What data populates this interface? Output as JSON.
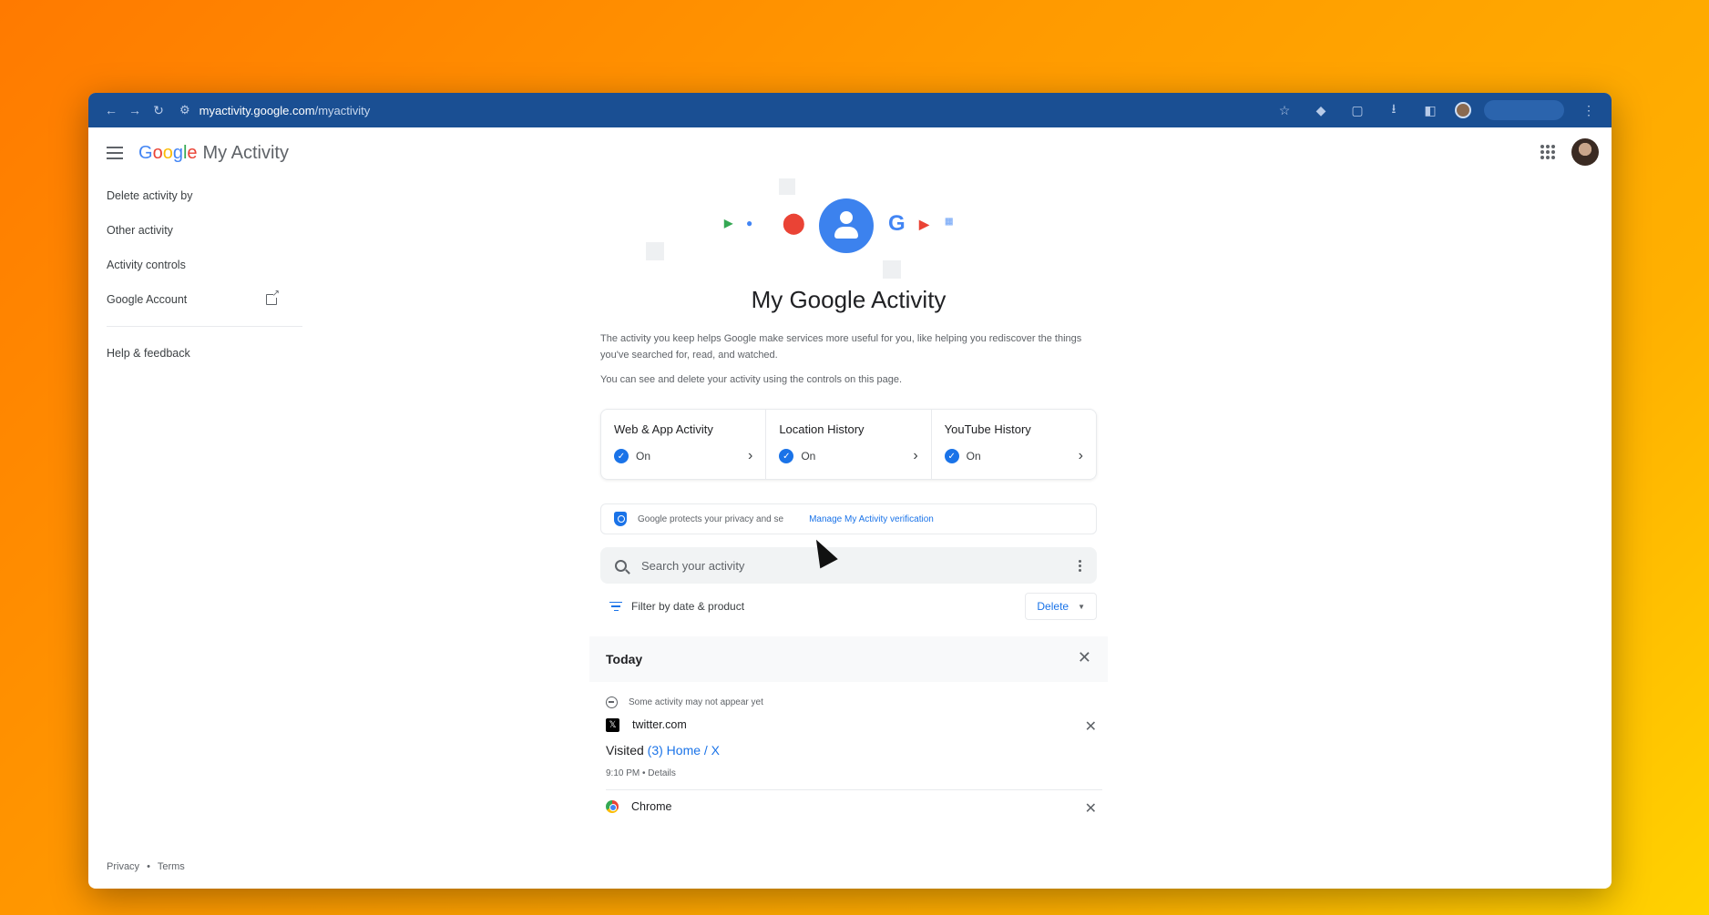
{
  "browser": {
    "url_host": "myactivity.google.com",
    "url_path": "/myactivity"
  },
  "header": {
    "logo_letters": [
      "G",
      "o",
      "o",
      "g",
      "l",
      "e"
    ],
    "product_name": "My Activity"
  },
  "sidebar": {
    "items": [
      {
        "label": "Delete activity by"
      },
      {
        "label": "Other activity"
      },
      {
        "label": "Activity controls"
      },
      {
        "label": "Google Account"
      }
    ],
    "help_label": "Help & feedback",
    "footer": {
      "privacy": "Privacy",
      "separator": "•",
      "terms": "Terms"
    }
  },
  "main": {
    "title": "My Google Activity",
    "intro": "The activity you keep helps Google make services more useful for you, like helping you rediscover the things you've searched for, read, and watched.",
    "intro2": "You can see and delete your activity using the controls on this page.",
    "controls": [
      {
        "title": "Web & App Activity",
        "status": "On"
      },
      {
        "title": "Location History",
        "status": "On"
      },
      {
        "title": "YouTube History",
        "status": "On"
      }
    ],
    "privacy": {
      "text": "Google protects your privacy and se",
      "link": "Manage My Activity verification"
    },
    "search": {
      "placeholder": "Search your activity"
    },
    "filter_label": "Filter by date & product",
    "delete_label": "Delete",
    "today": {
      "label": "Today",
      "note": "Some activity may not appear yet",
      "entries": [
        {
          "site": "twitter.com",
          "visited_prefix": "Visited",
          "visited_link": "(3) Home / X",
          "meta": "9:10 PM • Details"
        },
        {
          "site": "Chrome"
        }
      ]
    }
  },
  "colors": {
    "browser_bar": "#1a4f93",
    "accent": "#1a73e8",
    "background_gradient_start": "#ff7a00",
    "background_gradient_end": "#ffd200"
  }
}
